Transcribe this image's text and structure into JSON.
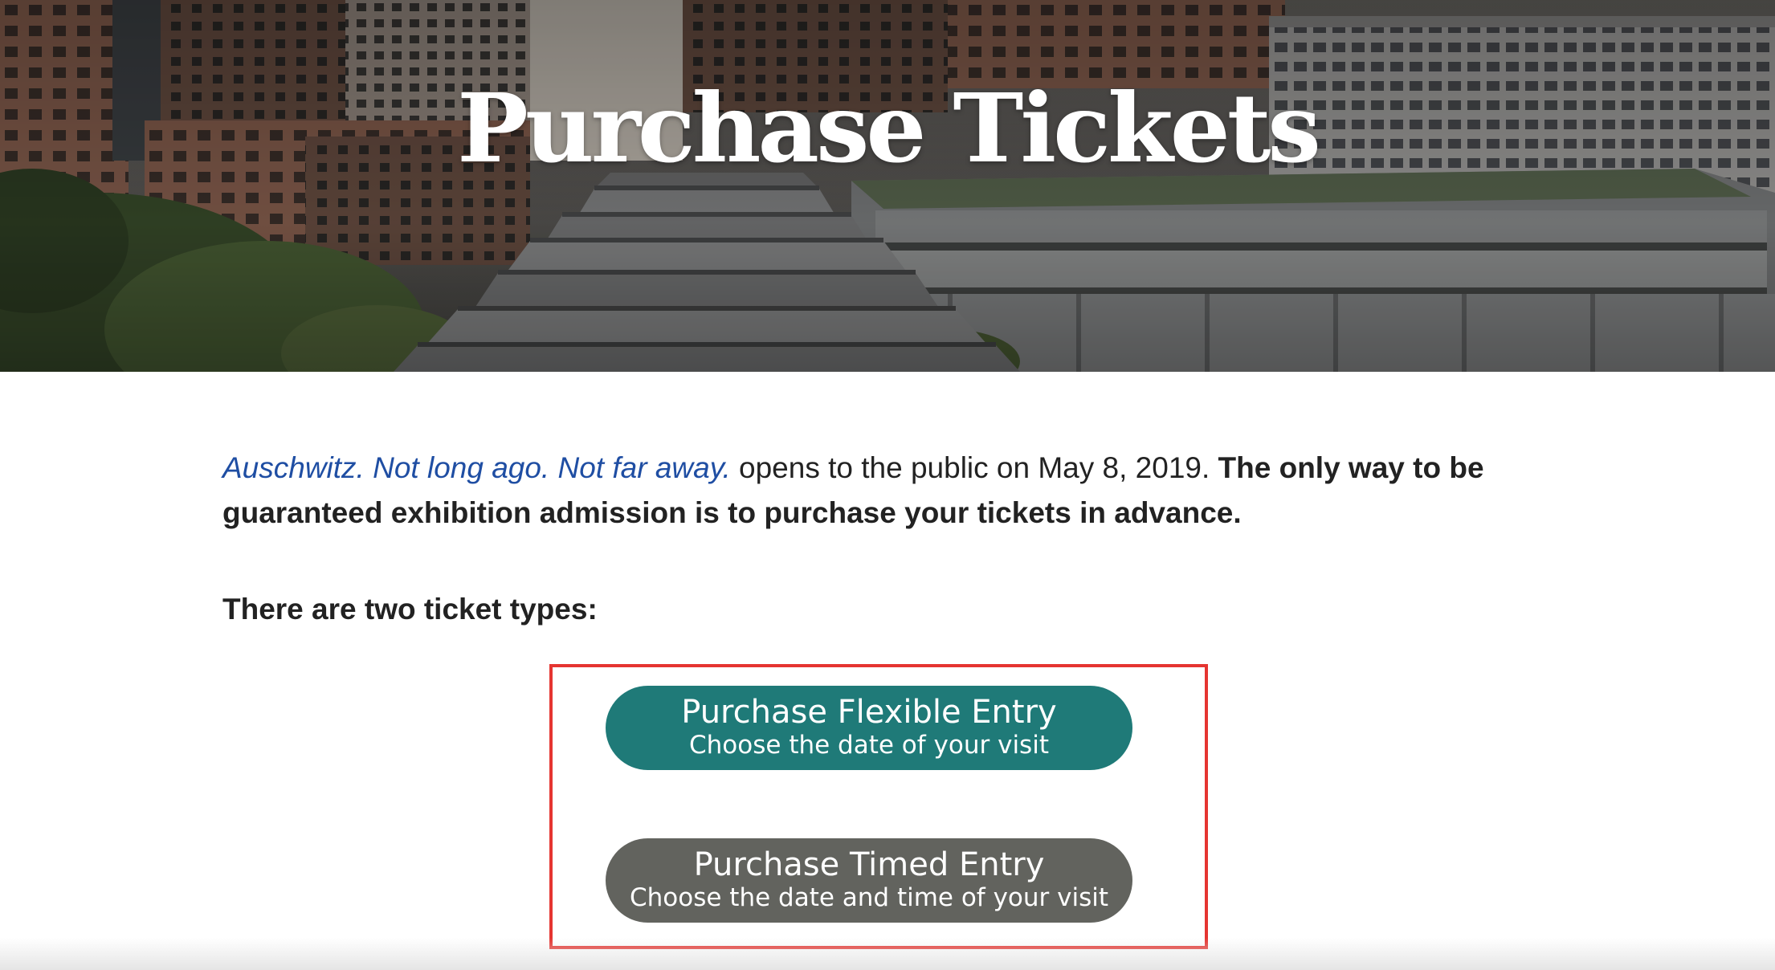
{
  "hero": {
    "title": "Purchase Tickets"
  },
  "intro": {
    "exhibition_link": "Auschwitz. Not long ago. Not far away.",
    "opens_text": " opens to the public on May 8, 2019. ",
    "bold_text": "The only way to be guaranteed exhibition admission is to purchase your tickets in advance."
  },
  "ticket_types": {
    "heading": "There are two ticket types:",
    "flexible": {
      "title": "Purchase Flexible Entry",
      "subtitle": "Choose the date of your visit",
      "color": "#1f7a78"
    },
    "timed": {
      "title": "Purchase Timed Entry",
      "subtitle": "Choose the date and time of your visit",
      "color": "#62635e"
    }
  },
  "colors": {
    "link": "#1f4ea3",
    "highlight_border": "#e53531"
  }
}
